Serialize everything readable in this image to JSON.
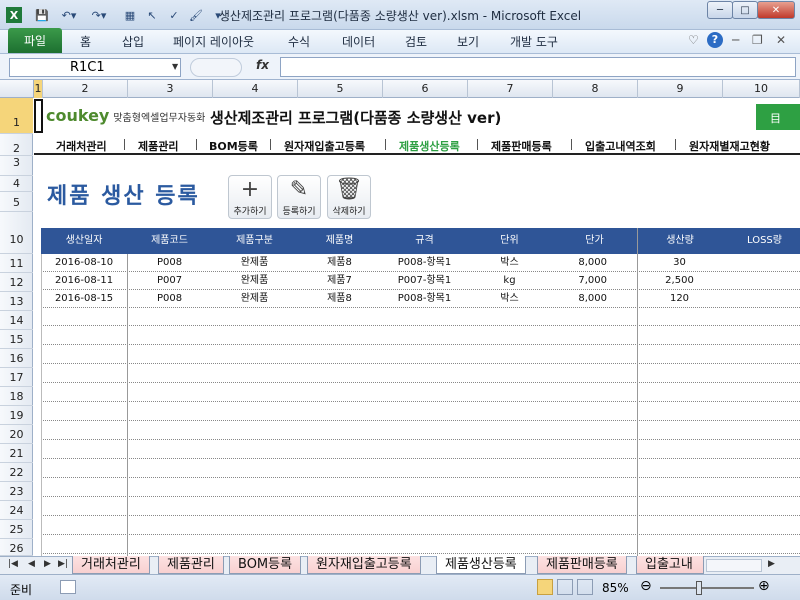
{
  "window": {
    "title": "생산제조관리 프로그램(다품종 소량생산 ver).xlsm - Microsoft Excel",
    "minimize": "─",
    "maximize": "□",
    "close": "✕"
  },
  "ribbon": {
    "file_tab": "파일",
    "tabs": [
      "홈",
      "삽입",
      "페이지 레이아웃",
      "수식",
      "데이터",
      "검토",
      "보기",
      "개발 도구"
    ],
    "help": "?"
  },
  "formula_bar": {
    "name_box": "R1C1",
    "fx": "fx",
    "content": ""
  },
  "column_headers": [
    "1",
    "2",
    "3",
    "4",
    "5",
    "6",
    "7",
    "8",
    "9",
    "10"
  ],
  "row_headers": [
    "1",
    "2",
    "3",
    "4",
    "5",
    "10",
    "11",
    "12",
    "13",
    "14",
    "15",
    "16",
    "17",
    "18",
    "19",
    "20",
    "21",
    "22",
    "23",
    "24",
    "25",
    "26"
  ],
  "brand": {
    "logo": "coukey",
    "logo_sub": "맞춤형엑셀업무자동화",
    "app_title": "생산제조관리 프로그램(다품종 소량생산 ver)",
    "green_button": "目"
  },
  "nav": {
    "items": [
      "거래처관리",
      "제품관리",
      "BOM등록",
      "원자재입출고등록",
      "제품생산등록",
      "제품판매등록",
      "입출고내역조회",
      "원자재별재고현황"
    ],
    "active_index": 4
  },
  "page": {
    "heading": "제품 생산 등록",
    "buttons": [
      {
        "icon": "+",
        "label": "추가하기"
      },
      {
        "icon": "✎",
        "label": "등록하기"
      },
      {
        "icon": "🗑",
        "label": "삭제하기"
      }
    ]
  },
  "table": {
    "headers": [
      "생산일자",
      "제품코드",
      "제품구분",
      "제품명",
      "규격",
      "단위",
      "단가",
      "생산량",
      "LOSS량"
    ],
    "rows": [
      [
        "2016-08-10",
        "P008",
        "완제품",
        "제품8",
        "P008-항목1",
        "박스",
        "8,000",
        "30",
        ""
      ],
      [
        "2016-08-11",
        "P007",
        "완제품",
        "제품7",
        "P007-항목1",
        "kg",
        "7,000",
        "2,500",
        ""
      ],
      [
        "2016-08-15",
        "P008",
        "완제품",
        "제품8",
        "P008-항목1",
        "박스",
        "8,000",
        "120",
        ""
      ]
    ]
  },
  "sheet_tabs": {
    "items": [
      "거래처관리",
      "제품관리",
      "BOM등록",
      "원자재입출고등록",
      "제품생산등록",
      "제품판매등록",
      "입출고내"
    ],
    "active_index": 4
  },
  "status": {
    "ready": "준비",
    "zoom": "85%",
    "zoom_fraction": 0.85
  }
}
